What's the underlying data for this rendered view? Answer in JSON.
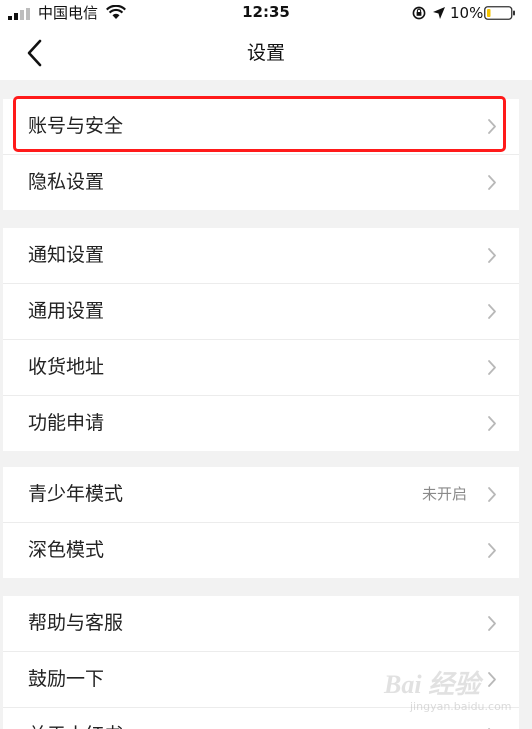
{
  "status_bar": {
    "carrier": "中国电信",
    "time": "12:35",
    "battery_percent": "10%"
  },
  "nav": {
    "title": "设置"
  },
  "groups": [
    {
      "items": [
        {
          "label": "账号与安全"
        },
        {
          "label": "隐私设置"
        }
      ]
    },
    {
      "items": [
        {
          "label": "通知设置"
        },
        {
          "label": "通用设置"
        },
        {
          "label": "收货地址"
        },
        {
          "label": "功能申请"
        }
      ]
    },
    {
      "items": [
        {
          "label": "青少年模式",
          "value": "未开启"
        },
        {
          "label": "深色模式"
        }
      ]
    },
    {
      "items": [
        {
          "label": "帮助与客服"
        },
        {
          "label": "鼓励一下"
        },
        {
          "label": "关于小红书"
        }
      ]
    }
  ],
  "colors": {
    "highlight": "#ff1a1a",
    "background": "#f2f2f2",
    "chevron": "#b8b8b8"
  },
  "icons": {
    "back": "chevron-left-icon",
    "row_arrow": "chevron-right-icon",
    "signal": "signal-icon",
    "wifi": "wifi-icon",
    "lock": "rotation-lock-icon",
    "location": "location-arrow-icon",
    "battery": "battery-icon"
  },
  "watermark": {
    "brand": "Bai 经验",
    "url": "jingyan.baidu.com"
  }
}
